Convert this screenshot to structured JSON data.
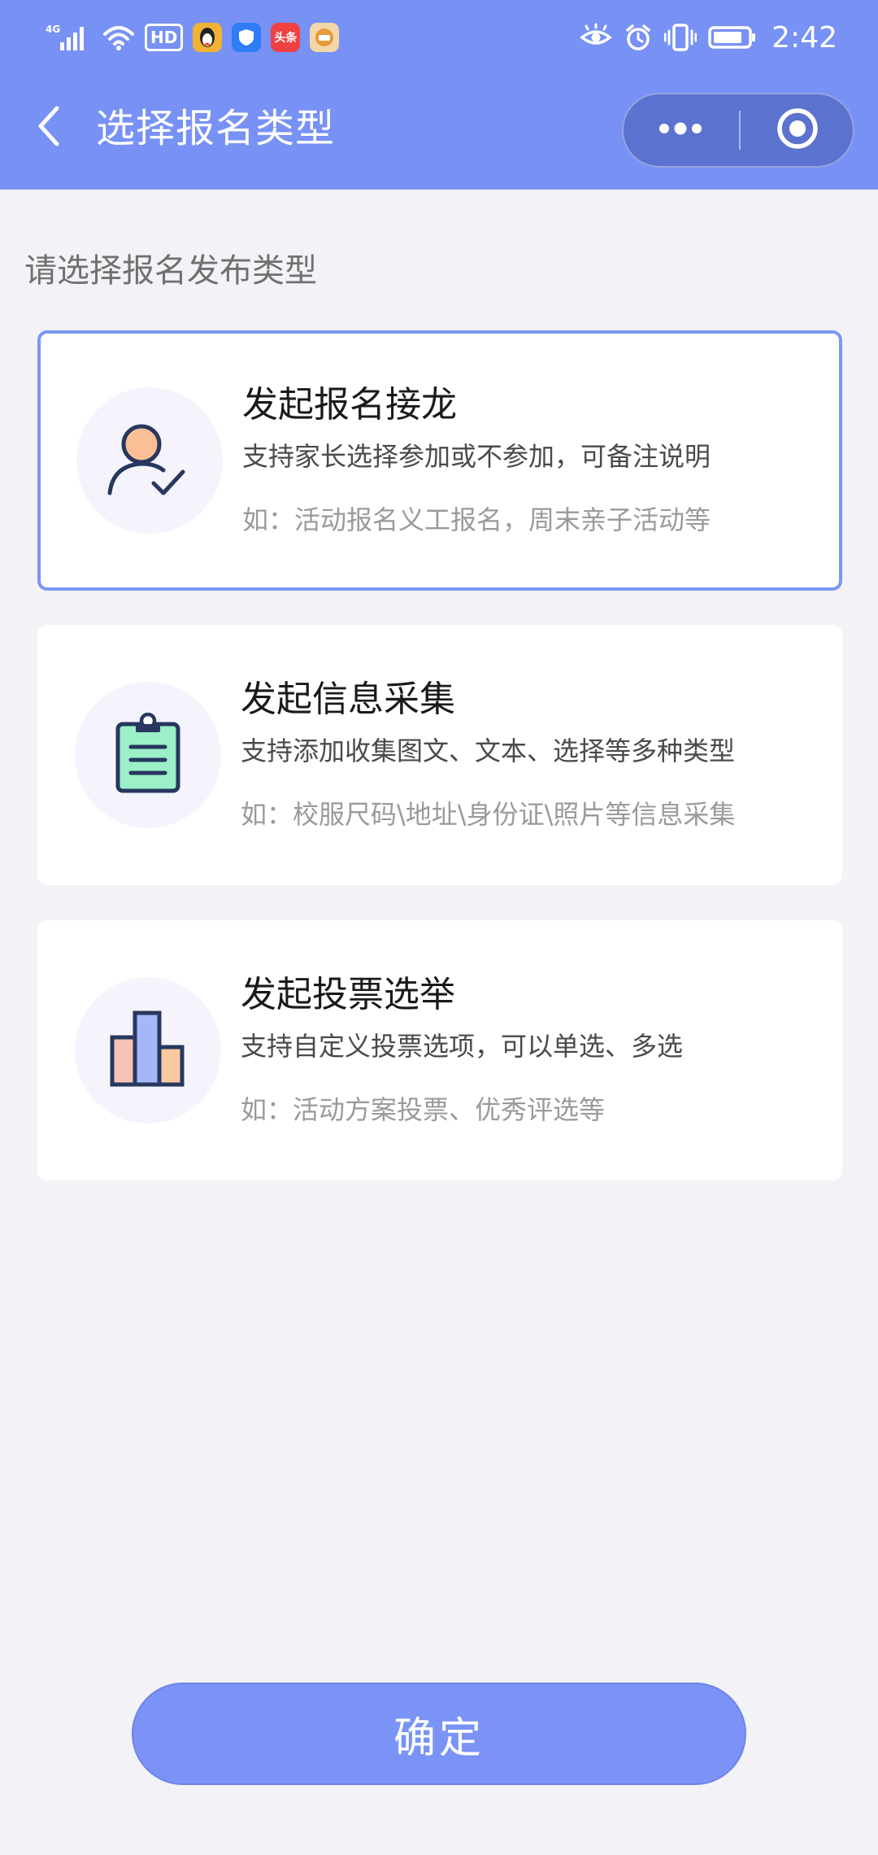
{
  "colors": {
    "header": "#7891f5",
    "capsule": "#5c72cf",
    "background": "#f3f2f6",
    "selected_border": "#7d96f5",
    "confirm_button": "#7b93f6"
  },
  "status_bar": {
    "network": "4G",
    "hd_label": "HD",
    "toutiao_label": "头条",
    "time": "2:42",
    "icons": [
      "signal-icon",
      "wifi-icon",
      "hd-icon",
      "qq-icon",
      "shield-icon",
      "toutiao-icon",
      "app-icon",
      "eye-icon",
      "alarm-icon",
      "vibrate-icon",
      "battery-icon"
    ]
  },
  "nav": {
    "title": "选择报名类型",
    "back_icon": "chevron-left-icon",
    "more_icon": "more-dots-icon",
    "close_icon": "target-circle-icon"
  },
  "section_label": "请选择报名发布类型",
  "cards": [
    {
      "icon": "person-check-icon",
      "title": "发起报名接龙",
      "desc": "支持家长选择参加或不参加，可备注说明",
      "example": "如：活动报名义工报名，周末亲子活动等",
      "selected": true
    },
    {
      "icon": "clipboard-icon",
      "title": "发起信息采集",
      "desc": "支持添加收集图文、文本、选择等多种类型",
      "example": "如：校服尺码\\地址\\身份证\\照片等信息采集",
      "selected": false
    },
    {
      "icon": "bar-chart-icon",
      "title": "发起投票选举",
      "desc": "支持自定义投票选项，可以单选、多选",
      "example": "如：活动方案投票、优秀评选等",
      "selected": false
    }
  ],
  "confirm_button": "确定"
}
